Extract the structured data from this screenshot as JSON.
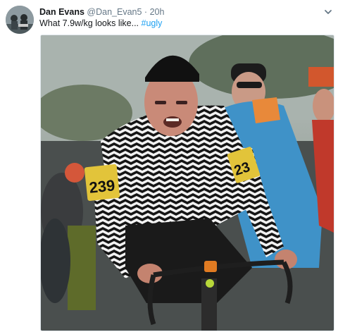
{
  "tweet": {
    "author_name": "Dan Evans",
    "handle": "@Dan_Evan5",
    "separator": "·",
    "time": "20h",
    "text": "What 7.9w/kg looks like...",
    "hashtag": "#ugly"
  },
  "photo": {
    "bib_left": "239",
    "bib_right": "23"
  },
  "icons": {
    "avatar": "avatar",
    "caret": "chevron-down-icon"
  },
  "colors": {
    "link": "#1da1f2",
    "secondary_text": "#657786",
    "primary_text": "#14171a"
  }
}
